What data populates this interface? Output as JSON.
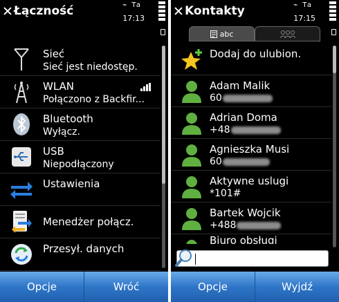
{
  "left": {
    "title": "Łączność",
    "time": "17:13",
    "items": [
      {
        "icon": "antenna-icon",
        "title": "Sieć",
        "subtitle": "Sieć jest niedostęp."
      },
      {
        "icon": "wlan-icon",
        "title": "WLAN",
        "subtitle": "Połączono z Backfir..."
      },
      {
        "icon": "bluetooth-icon",
        "title": "Bluetooth",
        "subtitle": "Wyłącz."
      },
      {
        "icon": "usb-icon",
        "title": "USB",
        "subtitle": "Niepodłączony"
      },
      {
        "icon": "settings-arrows-icon",
        "title": "Ustawienia"
      },
      {
        "icon": "connection-manager-icon",
        "title": "Menedżer połącz."
      },
      {
        "icon": "sync-icon",
        "title": "Przesył. danych"
      }
    ],
    "softkeys": {
      "left": "Opcje",
      "right": "Wróć"
    }
  },
  "right": {
    "title": "Kontakty",
    "time": "17:15",
    "tabs": {
      "active": "abc"
    },
    "contacts": [
      {
        "icon": "star-add-icon",
        "name": "Dodaj do ulubion.",
        "number": ""
      },
      {
        "icon": "person-icon",
        "name": "Adam Malik",
        "number": "60"
      },
      {
        "icon": "person-icon",
        "name": "Adrian Doma",
        "number": "+48"
      },
      {
        "icon": "person-icon",
        "name": "Agnieszka Musi",
        "number": "60"
      },
      {
        "icon": "person-icon",
        "name": "Aktywne uslugi",
        "number": "*101#"
      },
      {
        "icon": "person-icon",
        "name": "Bartek Wojcik",
        "number": "+488"
      },
      {
        "icon": "person-icon",
        "name": "Biuro obsługi",
        "number": ""
      }
    ],
    "softkeys": {
      "left": "Opcje",
      "right": "Wyjdź"
    }
  },
  "status_indicator": "Ta",
  "colors": {
    "softkey_top": "#6aa9e8",
    "softkey_bottom": "#1f5fae",
    "contact_green": "#5fb040",
    "star_yellow": "#f3c51f"
  }
}
